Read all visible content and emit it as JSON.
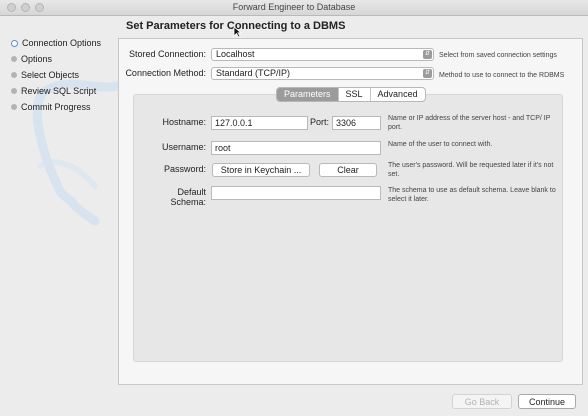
{
  "window": {
    "title": "Forward Engineer to Database"
  },
  "sidebar": {
    "items": [
      {
        "label": "Connection Options",
        "state": "active"
      },
      {
        "label": "Options",
        "state": "pending"
      },
      {
        "label": "Select Objects",
        "state": "pending"
      },
      {
        "label": "Review SQL Script",
        "state": "pending"
      },
      {
        "label": "Commit Progress",
        "state": "pending"
      }
    ]
  },
  "main": {
    "heading": "Set Parameters for Connecting to a DBMS",
    "stored_connection": {
      "label": "Stored Connection:",
      "value": "Localhost",
      "hint": "Select from saved connection settings"
    },
    "connection_method": {
      "label": "Connection Method:",
      "value": "Standard (TCP/IP)",
      "hint": "Method to use to connect to the RDBMS"
    },
    "tabs": [
      {
        "label": "Parameters",
        "selected": true
      },
      {
        "label": "SSL",
        "selected": false
      },
      {
        "label": "Advanced",
        "selected": false
      }
    ],
    "hostname": {
      "label": "Hostname:",
      "value": "127.0.0.1",
      "hint": "Name or IP address of the server host - and TCP/ IP port."
    },
    "port": {
      "label": "Port:",
      "value": "3306"
    },
    "username": {
      "label": "Username:",
      "value": "root",
      "hint": "Name of the user to connect with."
    },
    "password": {
      "label": "Password:",
      "store_button": "Store in Keychain ...",
      "clear_button": "Clear",
      "hint": "The user's password. Will be requested later if it's not set."
    },
    "default_schema": {
      "label": "Default Schema:",
      "value": "",
      "hint": "The schema to use as default schema. Leave blank to select it later."
    }
  },
  "footer": {
    "back_label": "Go Back",
    "continue_label": "Continue"
  },
  "colors": {
    "accent": "#5a8fd0",
    "selected_tab": "#9b9b9b"
  }
}
